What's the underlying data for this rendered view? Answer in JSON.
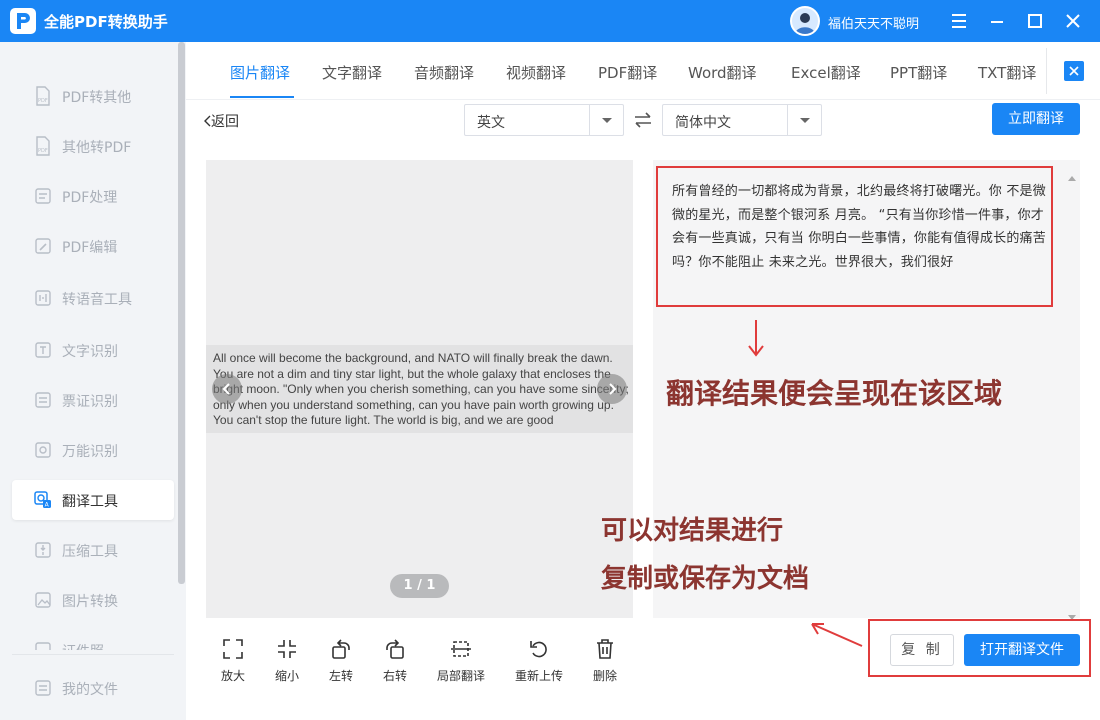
{
  "app": {
    "title": "全能PDF转换助手",
    "user_name": "福伯天天不聪明"
  },
  "sidebar": {
    "items": [
      {
        "label": "PDF转其他",
        "icon": "pdf-export-icon"
      },
      {
        "label": "其他转PDF",
        "icon": "pdf-import-icon"
      },
      {
        "label": "PDF处理",
        "icon": "pdf-process-icon"
      },
      {
        "label": "PDF编辑",
        "icon": "pdf-edit-icon"
      },
      {
        "label": "转语音工具",
        "icon": "speech-icon"
      },
      {
        "label": "文字识别",
        "icon": "text-ocr-icon"
      },
      {
        "label": "票证识别",
        "icon": "ticket-ocr-icon"
      },
      {
        "label": "万能识别",
        "icon": "universal-ocr-icon"
      },
      {
        "label": "翻译工具",
        "icon": "translate-icon",
        "active": true
      },
      {
        "label": "压缩工具",
        "icon": "compress-icon"
      },
      {
        "label": "图片转换",
        "icon": "image-convert-icon"
      },
      {
        "label": "证件照",
        "icon": "id-photo-icon"
      },
      {
        "label": "我的文件",
        "icon": "my-files-icon"
      }
    ]
  },
  "tabs": [
    "图片翻译",
    "文字翻译",
    "音频翻译",
    "视频翻译",
    "PDF翻译",
    "Word翻译",
    "Excel翻译",
    "PPT翻译",
    "TXT翻译"
  ],
  "toolbar": {
    "back_label": "返回",
    "source_lang": "英文",
    "target_lang": "简体中文",
    "translate_label": "立即翻译"
  },
  "source": {
    "text": "All once will become the background, and NATO will finally break the dawn. You are not a dim and tiny star light, but the whole galaxy that encloses the bright moon. \"Only when you cherish something, can you have some sincerity; only when you understand something, can you have pain worth growing up. You can't stop the future light. The world is big, and we are good",
    "pager": "1 / 1"
  },
  "result": {
    "text": "所有曾经的一切都将成为背景，北约最终将打破曙光。你 不是微微的星光，而是整个银河系 月亮。 “只有当你珍惜一件事，你才会有一些真诚，只有当 你明白一些事情，你能有值得成长的痛苦吗？你不能阻止 未来之光。世界很大，我们很好"
  },
  "annotations": {
    "result_area": "翻译结果便会呈现在该区域",
    "action_line1": "可以对结果进行",
    "action_line2": "复制或保存为文档"
  },
  "actions": {
    "copy_label": "复 制",
    "open_label": "打开翻译文件"
  },
  "tools": [
    {
      "label": "放大",
      "icon": "zoom-in-icon"
    },
    {
      "label": "缩小",
      "icon": "zoom-out-icon"
    },
    {
      "label": "左转",
      "icon": "rotate-left-icon"
    },
    {
      "label": "右转",
      "icon": "rotate-right-icon"
    },
    {
      "label": "局部翻译",
      "icon": "partial-translate-icon"
    },
    {
      "label": "重新上传",
      "icon": "reupload-icon"
    },
    {
      "label": "删除",
      "icon": "delete-icon"
    }
  ],
  "colors": {
    "accent": "#1a86f5",
    "annotation": "#8c3530",
    "highlight_border": "#e03c3c"
  }
}
